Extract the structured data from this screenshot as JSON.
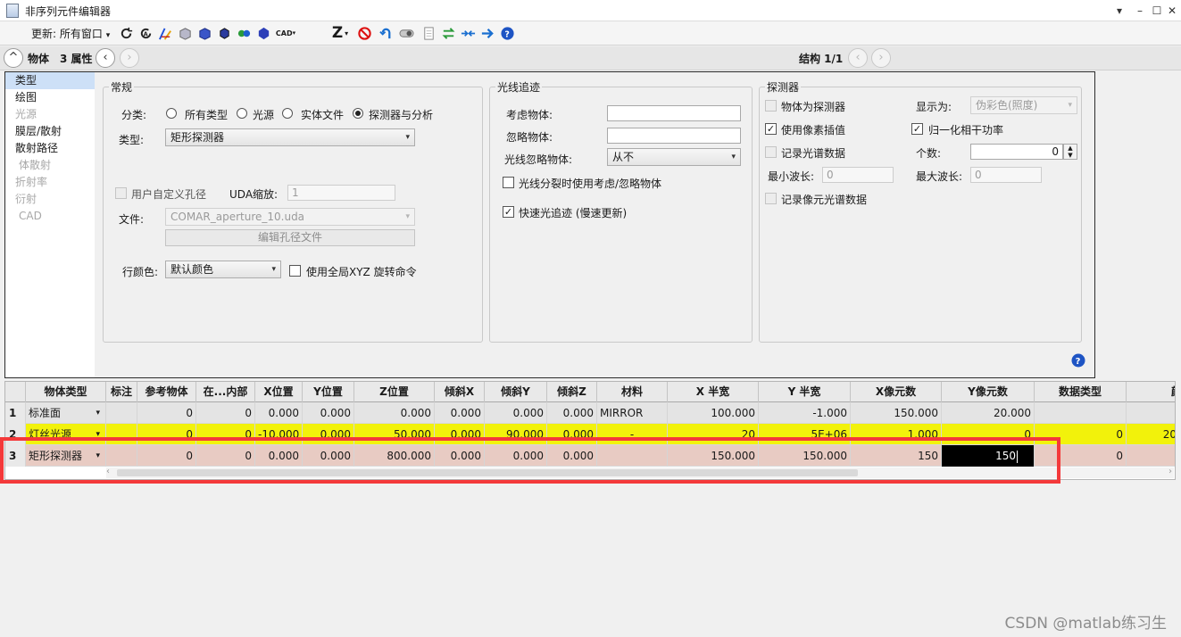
{
  "window": {
    "title": "非序列元件编辑器",
    "minimize": "▾",
    "restore": "–",
    "maximize": "☐",
    "close": "✕"
  },
  "toolbar": {
    "update_label": "更新: 所有窗口",
    "dropdown_arrow": "▾",
    "cad_label": "CAD",
    "z_label": "Z",
    "icons": [
      "refresh-icon",
      "refresh-all-icon",
      "layout-icon",
      "object-icon",
      "block-icon",
      "block2-icon",
      "ray-icon",
      "polygon-icon",
      "cad-icon",
      "z-icon",
      "no-icon",
      "undo-icon",
      "toggle-icon",
      "page-icon",
      "swap-icon",
      "shift-icon",
      "arrow-icon",
      "help-icon"
    ]
  },
  "objbar": {
    "collapse": "^",
    "object_label": "物体",
    "count_label": "3 属性",
    "prev": "‹",
    "next": "›",
    "structure_label": "结构 1/1"
  },
  "nav": {
    "items": [
      {
        "label": "类型",
        "state": "selected"
      },
      {
        "label": "绘图",
        "state": "normal"
      },
      {
        "label": "光源",
        "state": "disabled"
      },
      {
        "label": "膜层/散射",
        "state": "normal"
      },
      {
        "label": "散射路径",
        "state": "normal"
      },
      {
        "label": "体散射",
        "state": "disabled"
      },
      {
        "label": "折射率",
        "state": "disabled"
      },
      {
        "label": "衍射",
        "state": "disabled"
      },
      {
        "label": "CAD",
        "state": "disabled"
      }
    ]
  },
  "general": {
    "legend": "常规",
    "category_label": "分类:",
    "radios": [
      {
        "label": "所有类型",
        "checked": false
      },
      {
        "label": "光源",
        "checked": false
      },
      {
        "label": "实体文件",
        "checked": false
      },
      {
        "label": "探测器与分析",
        "checked": true
      }
    ],
    "type_label": "类型:",
    "type_value": "矩形探测器",
    "custom_aperture_label": "用户自定义孔径",
    "uda_scale_label": "UDA缩放:",
    "uda_scale_value": "1",
    "file_label": "文件:",
    "file_value": "COMAR_aperture_10.uda",
    "edit_aperture_label": "编辑孔径文件",
    "row_color_label": "行颜色:",
    "row_color_value": "默认颜色",
    "global_xyz_label": "使用全局XYZ 旋转命令"
  },
  "raytrace": {
    "legend": "光线追迹",
    "consider_label": "考虑物体:",
    "consider_value": "",
    "ignore_label": "忽略物体:",
    "ignore_value": "",
    "ray_ignore_label": "光线忽略物体:",
    "ray_ignore_value": "从不",
    "split_label": "光线分裂时使用考虑/忽略物体",
    "split_checked": false,
    "fast_label": "快速光追迹 (慢速更新)",
    "fast_checked": true
  },
  "detector": {
    "legend": "探测器",
    "is_detector_label": "物体为探测器",
    "pixel_interp_label": "使用像素插值",
    "pixel_interp_checked": true,
    "normalize_label": "归一化相干功率",
    "normalize_checked": true,
    "display_label": "显示为:",
    "display_value": "伪彩色(照度)",
    "record_spectral_label": "记录光谱数据",
    "count_label": "个数:",
    "count_value": "0",
    "min_wl_label": "最小波长:",
    "min_wl_value": "0",
    "max_wl_label": "最大波长:",
    "max_wl_value": "0",
    "record_pixel_spectral_label": "记录像元光谱数据"
  },
  "grid": {
    "columns": [
      "物体类型",
      "标注",
      "参考物体",
      "在...内部",
      "X位置",
      "Y位置",
      "Z位置",
      "倾斜X",
      "倾斜Y",
      "倾斜Z",
      "材料",
      "X 半宽",
      "Y 半宽",
      "X像元数",
      "Y像元数",
      "数据类型",
      "颜色"
    ],
    "rows": [
      {
        "num": "1",
        "type": "标准面",
        "cells": [
          "",
          "0",
          "0",
          "0.000",
          "0.000",
          "0.000",
          "0.000",
          "0.000",
          "0.000",
          "MIRROR",
          "100.000",
          "-1.000",
          "150.000",
          "20.000",
          "",
          ""
        ],
        "bg": "#e4e4e4"
      },
      {
        "num": "2",
        "type": "灯丝光源",
        "cells": [
          "",
          "0",
          "0",
          "-10.000",
          "0.000",
          "50.000",
          "0.000",
          "90.000",
          "0.000",
          "-",
          "20",
          "5E+06",
          "1.000",
          "0",
          "0",
          "20"
        ],
        "bg": "#f2f20b"
      },
      {
        "num": "3",
        "type": "矩形探测器",
        "cells": [
          "",
          "0",
          "0",
          "0.000",
          "0.000",
          "800.000",
          "0.000",
          "0.000",
          "0.000",
          "",
          "150.000",
          "150.000",
          "150",
          "150",
          "0",
          ""
        ],
        "bg": "#e8cbc3"
      }
    ],
    "editing_value": "150",
    "dropdown_arrow": "▾",
    "scroll_left": "‹",
    "scroll_right": "›"
  },
  "watermark": "CSDN @matlab练习生",
  "colors": {
    "highlight_box": "#f4393a",
    "edit_cell_bg": "#000000",
    "edit_cell_fg": "#ffffff"
  }
}
